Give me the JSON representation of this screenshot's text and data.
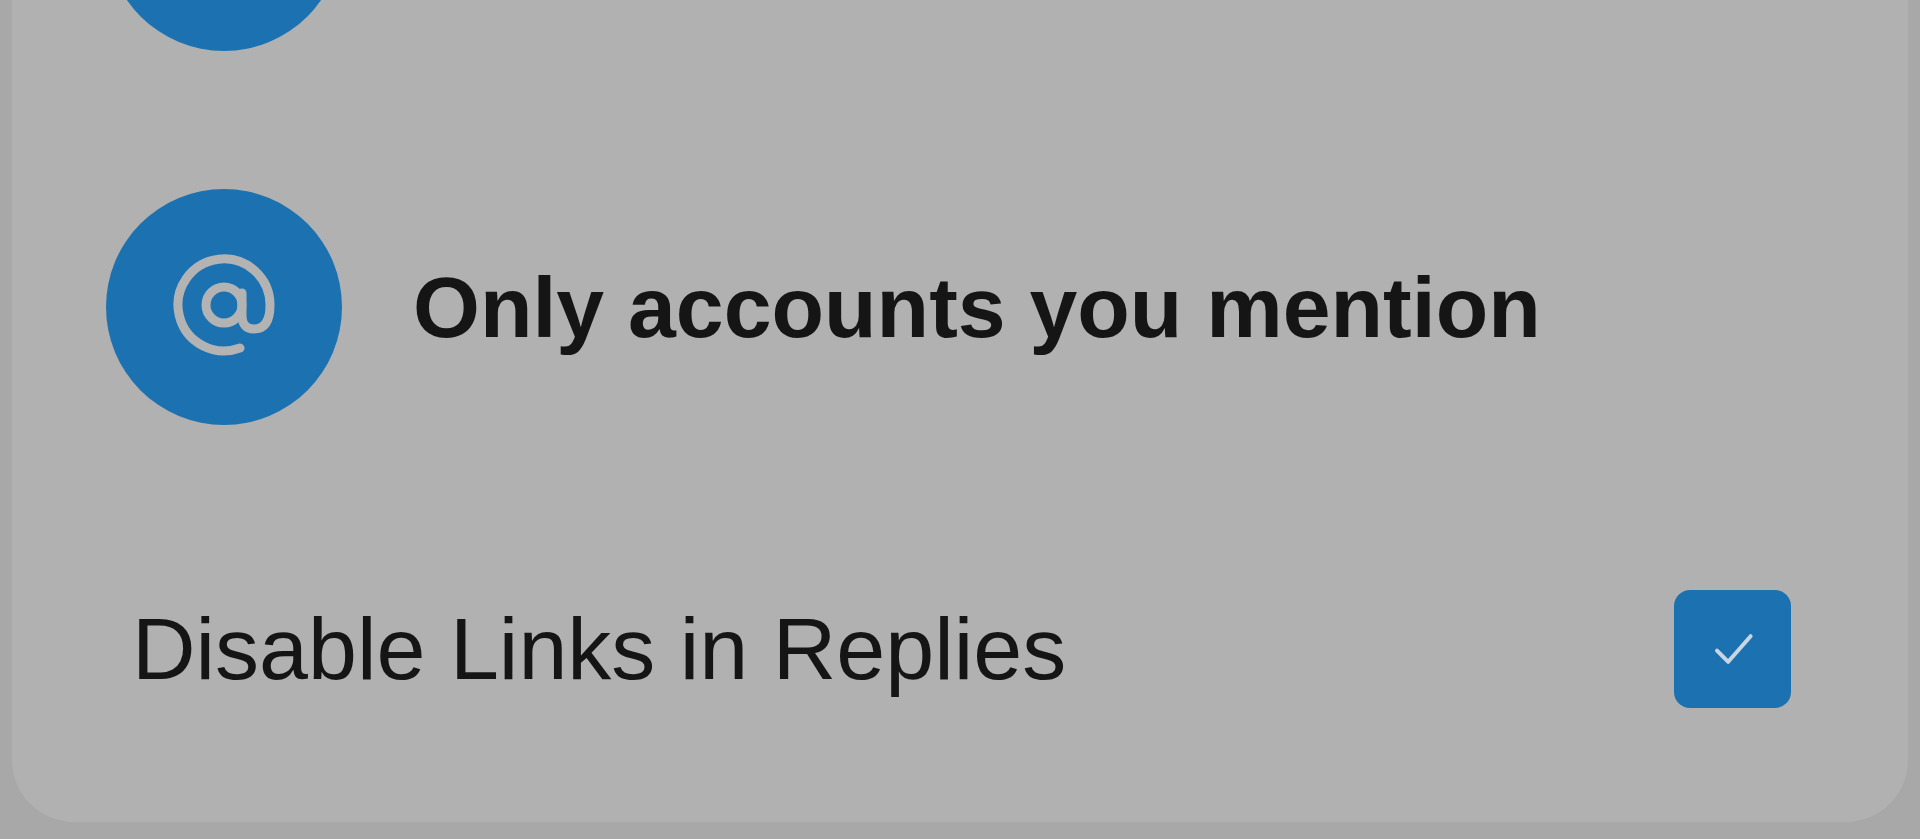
{
  "options": [
    {
      "label": "Only accounts you mention"
    }
  ],
  "settings": [
    {
      "label": "Disable Links in Replies",
      "checked": true
    }
  ]
}
